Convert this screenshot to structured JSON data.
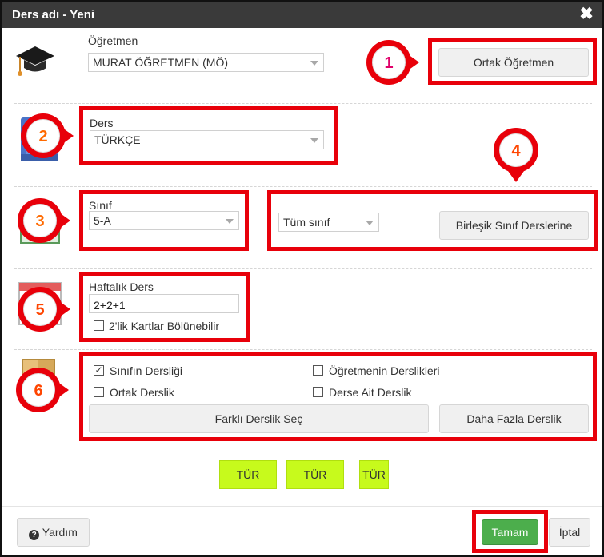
{
  "window": {
    "title": "Ders adı - Yeni",
    "close_glyph": "✖"
  },
  "teacher": {
    "label": "Öğretmen",
    "value": "MURAT ÖĞRETMEN (MÖ)",
    "icon": "graduation-cap-icon",
    "common_teacher_button": "Ortak Öğretmen"
  },
  "course": {
    "label": "Ders",
    "value": "TÜRKÇE",
    "icon": "book-icon"
  },
  "class": {
    "label": "Sınıf",
    "value": "5-A",
    "group_value": "Tüm sınıf",
    "combined_button": "Birleşik Sınıf Derslerine",
    "icon": "students-icon"
  },
  "weekly": {
    "label": "Haftalık Ders",
    "value": "2+2+1",
    "split_checkbox_label": "2'lik Kartlar Bölünebilir",
    "split_checked": false,
    "icon": "calendar-icon"
  },
  "classroom": {
    "icon": "door-icon",
    "options": [
      {
        "label": "Sınıfın Dersliği",
        "checked": true
      },
      {
        "label": "Öğretmenin Derslikleri",
        "checked": false
      },
      {
        "label": "Ortak Derslik",
        "checked": false
      },
      {
        "label": "Derse Ait Derslik",
        "checked": false
      }
    ],
    "choose_button": "Farklı Derslik Seç",
    "more_button": "Daha Fazla Derslik"
  },
  "tur_buttons": [
    "TÜR",
    "TÜR",
    "TÜR"
  ],
  "footer": {
    "help_button": "Yardım",
    "ok_button": "Tamam",
    "cancel_button": "İptal"
  },
  "annotations": [
    "1",
    "2",
    "3",
    "4",
    "5",
    "6"
  ],
  "colors": {
    "highlight": "#e8000a",
    "ok_green": "#4cae4c",
    "tur_green": "#c7fa1c",
    "titlebar": "#3a3a3a",
    "badge_digit": [
      "#e0006a",
      "#ff6a00",
      "#ff6a00",
      "#ff4500",
      "#ff4500",
      "#ff4500"
    ]
  }
}
